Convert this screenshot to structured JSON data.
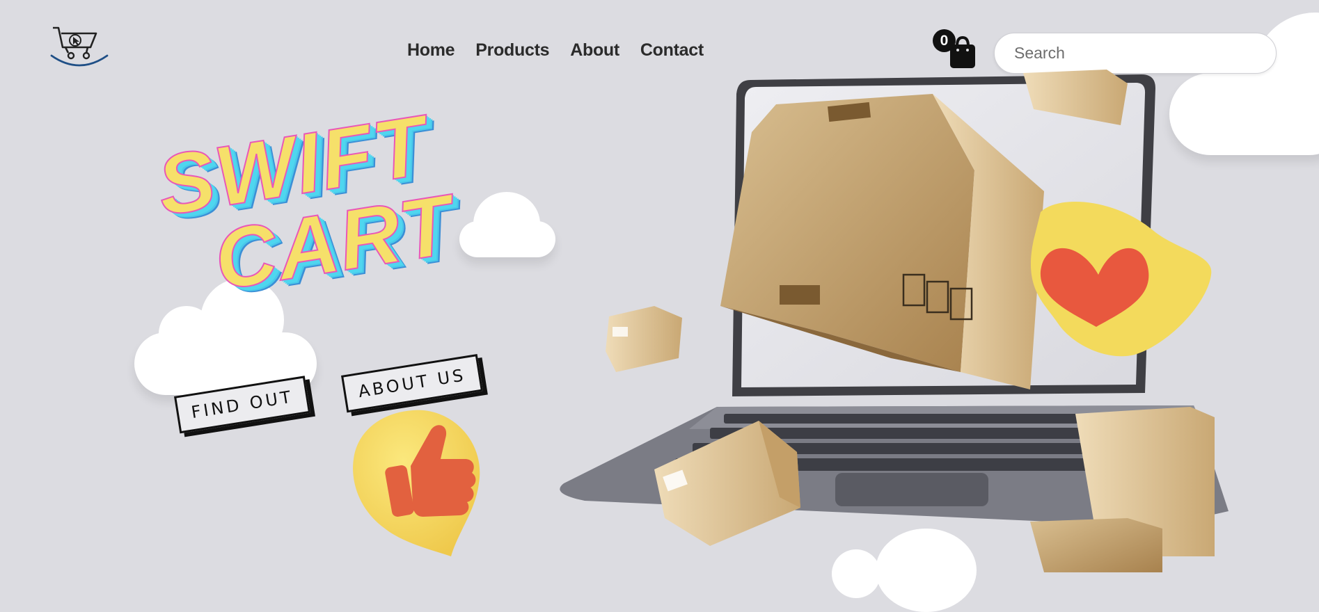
{
  "brand": {
    "logo_icon": "shopping-cart-cursor-logo"
  },
  "nav": {
    "items": [
      {
        "label": "Home"
      },
      {
        "label": "Products"
      },
      {
        "label": "About"
      },
      {
        "label": "Contact"
      }
    ]
  },
  "cart": {
    "count": "0",
    "icon": "shopping-bag-icon"
  },
  "search": {
    "placeholder": "Search",
    "value": ""
  },
  "hero": {
    "title_line1": "SWIFT",
    "title_line2": "CART",
    "buttons": {
      "find_out": "FIND OUT",
      "about_us": "ABOUT US"
    }
  },
  "colors": {
    "background": "#dcdce1",
    "title_fill": "#f6e06a",
    "title_outline": "#e957b8",
    "title_shadow": "#4fd6ef",
    "text": "#2b2b2b"
  }
}
